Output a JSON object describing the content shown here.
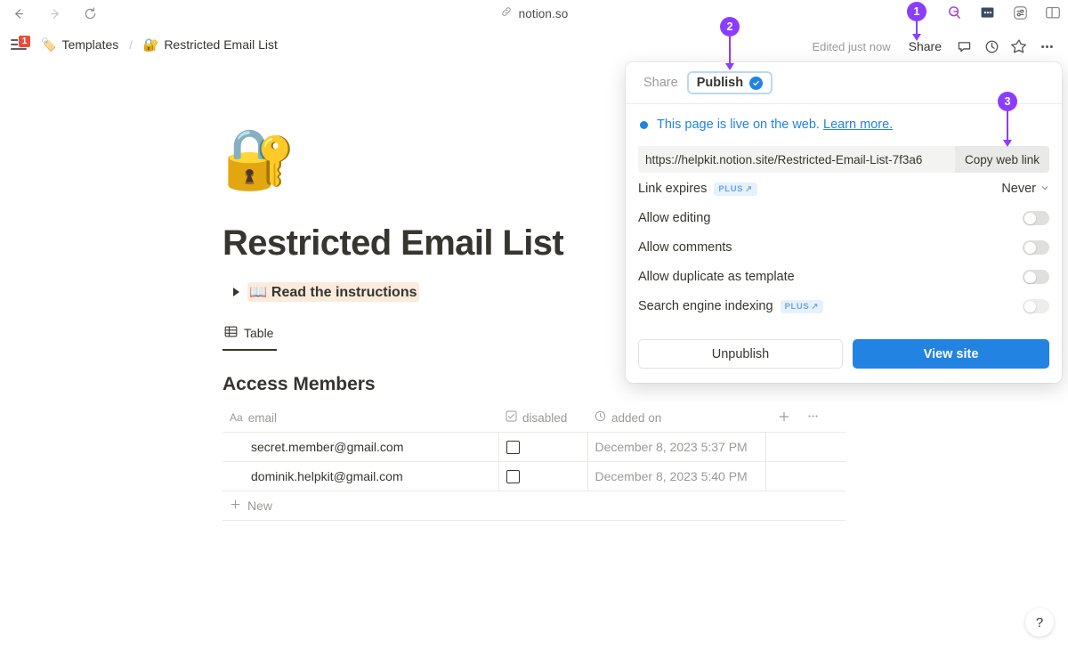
{
  "browser": {
    "back_icon": "arrow-left-icon",
    "forward_icon": "arrow-right-icon",
    "reload_icon": "reload-icon",
    "link_icon": "link-icon",
    "url": "notion.so",
    "extensions": [
      {
        "name": "grammarly-extension-icon",
        "glyph": "✦"
      },
      {
        "name": "dots-extension-icon",
        "glyph": "•••"
      },
      {
        "name": "settings-extension-icon",
        "glyph": "⇆"
      },
      {
        "name": "sidebar-panel-icon",
        "glyph": "▥"
      }
    ]
  },
  "topbar": {
    "sidebar_badge": "1",
    "breadcrumb": [
      {
        "emoji": "🏷️",
        "label": "Templates"
      },
      {
        "emoji": "🔐",
        "label": "Restricted Email List"
      }
    ],
    "separator": "/",
    "edited_status": "Edited just now",
    "share_label": "Share",
    "icons": [
      {
        "name": "comment-icon",
        "glyph": "💬"
      },
      {
        "name": "history-clock-icon",
        "glyph": "◴"
      },
      {
        "name": "favorite-star-icon",
        "glyph": "☆"
      },
      {
        "name": "more-options-icon",
        "glyph": "•••"
      }
    ]
  },
  "page": {
    "emoji": "🔐",
    "title": "Restricted Email List",
    "toggle_block": {
      "book_emoji": "📖",
      "label": "Read the instructions"
    },
    "tab_label": "Table",
    "tab_icon": "table-icon",
    "database_title": "Access Members",
    "columns": [
      {
        "icon": "text-type-icon",
        "icon_glyph": "Aa",
        "label": "email"
      },
      {
        "icon": "checkbox-type-icon",
        "icon_glyph": "☑",
        "label": "disabled"
      },
      {
        "icon": "date-type-icon",
        "icon_glyph": "◴",
        "label": "added on"
      }
    ],
    "add_column_icon": "plus-icon",
    "column_options_icon": "more-options-icon",
    "rows": [
      {
        "email": "secret.member@gmail.com",
        "disabled": false,
        "added_on": "December 8, 2023 5:37 PM"
      },
      {
        "email": "dominik.helpkit@gmail.com",
        "disabled": false,
        "added_on": "December 8, 2023 5:40 PM"
      }
    ],
    "new_row_label": "New"
  },
  "popover": {
    "tab_share": "Share",
    "tab_publish": "Publish",
    "publish_check_icon": "check-circle-icon",
    "status_text": "This page is live on the web.",
    "status_link": "Learn more.",
    "site_url": "https://helpkit.notion.site/Restricted-Email-List-7f3a6",
    "copy_button": "Copy web link",
    "settings": [
      {
        "label": "Link expires",
        "plus": true,
        "control": "select",
        "value": "Never"
      },
      {
        "label": "Allow editing",
        "plus": false,
        "control": "toggle",
        "on": false
      },
      {
        "label": "Allow comments",
        "plus": false,
        "control": "toggle",
        "on": false
      },
      {
        "label": "Allow duplicate as template",
        "plus": false,
        "control": "toggle",
        "on": false
      },
      {
        "label": "Search engine indexing",
        "plus": true,
        "control": "toggle",
        "on": false,
        "dim": true
      }
    ],
    "plus_badge_label": "PLUS",
    "plus_badge_arrow": "↗",
    "unpublish_button": "Unpublish",
    "view_site_button": "View site"
  },
  "annotations": [
    {
      "number": "1",
      "target": "share-button"
    },
    {
      "number": "2",
      "target": "publish-tab"
    },
    {
      "number": "3",
      "target": "copy-web-link-button"
    }
  ],
  "help_button": "?",
  "colors": {
    "accent_blue": "#2383e2",
    "annotation_purple": "#8b3dff",
    "badge_red": "#eb4d3d",
    "highlight_peach": "#faebdd"
  }
}
